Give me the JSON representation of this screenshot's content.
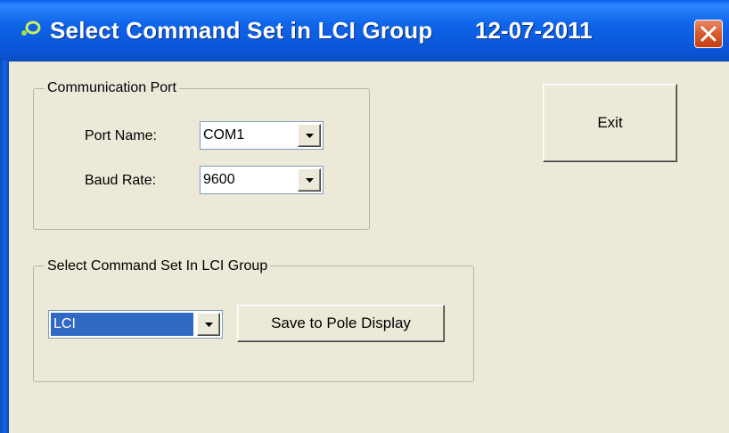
{
  "window": {
    "title": "Select Command Set in LCI Group",
    "date": "12-07-2011"
  },
  "communication_port": {
    "group_label": "Communication Port",
    "port_name": {
      "label": "Port Name:",
      "value": "COM1"
    },
    "baud_rate": {
      "label": "Baud Rate:",
      "value": "9600"
    }
  },
  "command_set": {
    "group_label": "Select Command Set In LCI Group",
    "selected": "LCI",
    "save_label": "Save to Pole Display"
  },
  "exit_label": "Exit",
  "colors": {
    "titlebar": "#0a56d8",
    "window_bg": "#ece9d8",
    "selection": "#316ac5",
    "close_button": "#d85a2a"
  },
  "icons": {
    "app": "app-logo-icon",
    "close": "close-icon",
    "dropdown": "dropdown-arrow-icon"
  }
}
